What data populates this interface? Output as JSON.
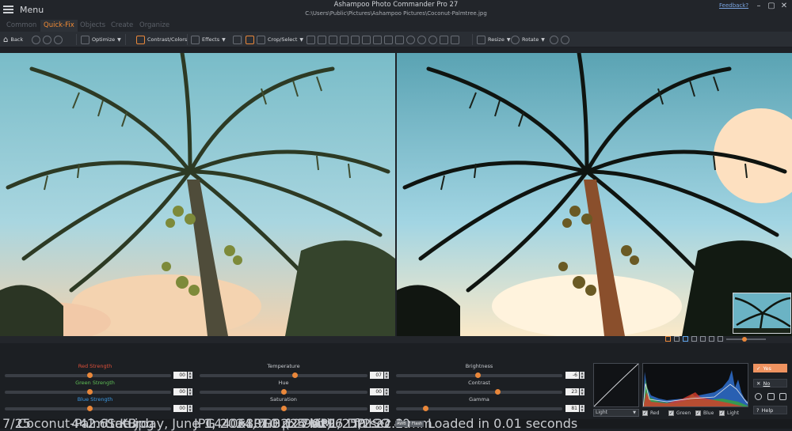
{
  "titlebar": {
    "menu_label": "Menu",
    "app_title": "Ashampoo Photo Commander Pro 27",
    "file_path": "C:\\Users\\Public\\Pictures\\Ashampoo Pictures\\Coconut-Palmtree.jpg",
    "feedback": "Feedback?",
    "minimize": "–",
    "maximize": "▢",
    "close": "✕"
  },
  "tabs": [
    "Common",
    "Quick-Fix",
    "Objects",
    "Create",
    "Organize"
  ],
  "active_tab": "Quick-Fix",
  "toolbar": {
    "back": "Back",
    "optimize": "Optimize",
    "contrast_colors": "Contrast/Colors",
    "effects": "Effects",
    "crop_select": "Crop/Select",
    "resize": "Resize",
    "rotate": "Rotate"
  },
  "sliders": {
    "red_strength": {
      "label": "Red Strength",
      "value": "00",
      "color": "#e0503a"
    },
    "green_strength": {
      "label": "Green Strength",
      "value": "00",
      "color": "#5fbf56"
    },
    "blue_strength": {
      "label": "Blue Strength",
      "value": "00",
      "color": "#3d9be6"
    },
    "temperature": {
      "label": "Temperature",
      "value": "07"
    },
    "hue": {
      "label": "Hue",
      "value": "00"
    },
    "saturation": {
      "label": "Saturation",
      "value": "00"
    },
    "brightness": {
      "label": "Brightness",
      "value": "-6"
    },
    "contrast": {
      "label": "Contrast",
      "value": "23"
    },
    "gamma": {
      "label": "Gamma",
      "value": "81"
    }
  },
  "curve": {
    "channel": "Light"
  },
  "histogram_checks": [
    "Red",
    "Green",
    "Blue",
    "Light"
  ],
  "actions": {
    "yes": "Yes",
    "no": "No",
    "help": "Help"
  },
  "status": {
    "index": "7/25",
    "filename": "Coconut-Palmtree.jpg",
    "filesize": "442.61 KB",
    "date": "Saturday, June 1, 2024, 7:02:27 AM",
    "format": "JPG",
    "dimensions": "1440x1010 px",
    "zoom": "68 %",
    "color_mode": "RGB (24 bit)",
    "megapixels": "1.5 MP",
    "dpi": "96x96 DPI",
    "shutter": "1/250 sec.",
    "aperture": "f/2.2",
    "iso": "ISO 40",
    "focal": "2.2 mm",
    "wb_badge": "AWB",
    "flash_badge": "Flash",
    "loaded": "Loaded in 0.01 seconds"
  },
  "colors": {
    "accent": "#e9873a",
    "yes_button": "#ef9360"
  }
}
